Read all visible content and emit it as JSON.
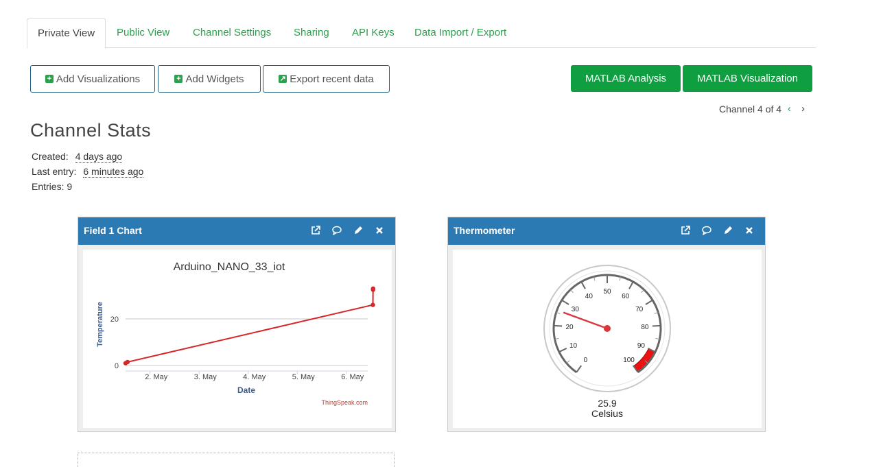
{
  "tabs": [
    "Private View",
    "Public View",
    "Channel Settings",
    "Sharing",
    "API Keys",
    "Data Import / Export"
  ],
  "toolbar": {
    "add_visualizations": "Add Visualizations",
    "add_widgets": "Add Widgets",
    "export_recent": "Export recent data",
    "matlab_analysis": "MATLAB Analysis",
    "matlab_visualization": "MATLAB Visualization"
  },
  "channel_nav": {
    "label": "Channel 4 of 4",
    "prev": "‹",
    "next": "›"
  },
  "stats": {
    "title": "Channel Stats",
    "created_label": "Created:",
    "created_value": "4 days ago",
    "last_entry_label": "Last entry:",
    "last_entry_value": "6 minutes ago",
    "entries_label": "Entries:",
    "entries_value": "9"
  },
  "field_chart": {
    "header": "Field 1 Chart",
    "credit": "ThingSpeak.com",
    "chart_data": {
      "type": "line",
      "title": "Arduino_NANO_33_iot",
      "xlabel": "Date",
      "ylabel": "Temperature",
      "x_ticks": [
        "2. May",
        "3. May",
        "4. May",
        "5. May",
        "6. May"
      ],
      "y_ticks": [
        0,
        20
      ],
      "ylim": [
        0,
        35
      ],
      "series": [
        {
          "values": [
            {
              "x": "2026-05-01T12:00",
              "y": 1
            },
            {
              "x": "2026-05-01T13:00",
              "y": 1.5
            },
            {
              "x": "2026-05-06T13:00",
              "y": 26
            },
            {
              "x": "2026-05-06T13:05",
              "y": 32.5
            },
            {
              "x": "2026-05-06T13:06",
              "y": 33
            }
          ],
          "color": "#d62728"
        }
      ]
    }
  },
  "thermometer": {
    "header": "Thermometer",
    "value": "25.9",
    "unit": "Celsius",
    "gauge": {
      "min": 0,
      "max": 100,
      "value": 25.9,
      "red_from": 90,
      "red_to": 100,
      "ticks": [
        "0",
        "10",
        "20",
        "30",
        "40",
        "50",
        "60",
        "70",
        "80",
        "90",
        "100"
      ]
    }
  },
  "colors": {
    "accent": "#2ba04d",
    "header": "#2c7ab3",
    "button_green": "#0f9f41",
    "line": "#d62728"
  }
}
